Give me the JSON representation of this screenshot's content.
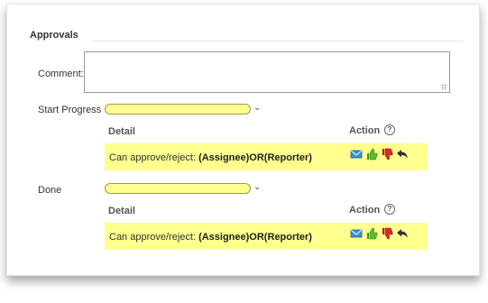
{
  "section": {
    "title": "Approvals"
  },
  "comment": {
    "label": "Comment:",
    "value": ""
  },
  "workflows": [
    {
      "label": "Start Progress",
      "selected": "",
      "detail_header": "Detail",
      "action_header": "Action",
      "rule_prefix": "Can approve/reject: ",
      "rule_value": "(Assignee)OR(Reporter)"
    },
    {
      "label": "Done",
      "selected": "",
      "detail_header": "Detail",
      "action_header": "Action",
      "rule_prefix": "Can approve/reject: ",
      "rule_value": "(Assignee)OR(Reporter)"
    }
  ],
  "icons": {
    "help": "?",
    "mail": "mail-icon",
    "approve": "thumbs-up-icon",
    "reject": "thumbs-down-icon",
    "back": "reply-arrow-icon"
  },
  "colors": {
    "highlight": "#ffff8f"
  }
}
